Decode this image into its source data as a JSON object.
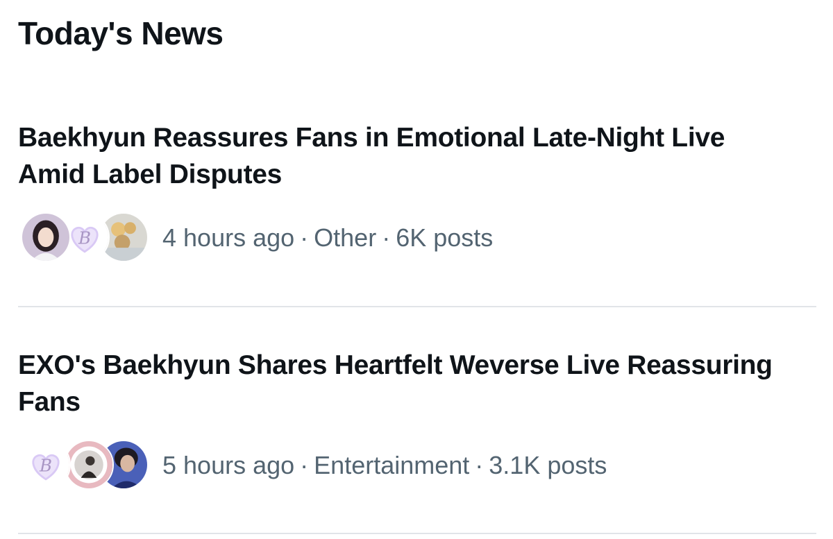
{
  "section": {
    "title": "Today's News"
  },
  "news": [
    {
      "headline": "Baekhyun Reassures Fans in Emotional Late-Night Live Amid Label Disputes",
      "time": "4 hours ago",
      "category": "Other",
      "posts": "6K posts",
      "avatars": [
        "avatar-photo-woman",
        "avatar-b-logo",
        "avatar-balloons"
      ]
    },
    {
      "headline": "EXO's Baekhyun Shares Heartfelt Weverse Live Reassuring Fans",
      "time": "5 hours ago",
      "category": "Entertainment",
      "posts": "3.1K posts",
      "avatars": [
        "avatar-b-logo",
        "avatar-photo-frame",
        "avatar-photo-man"
      ]
    }
  ],
  "separator": "·",
  "colors": {
    "text_primary": "#0f1419",
    "text_secondary": "#536471",
    "divider": "#e1e4e8"
  }
}
